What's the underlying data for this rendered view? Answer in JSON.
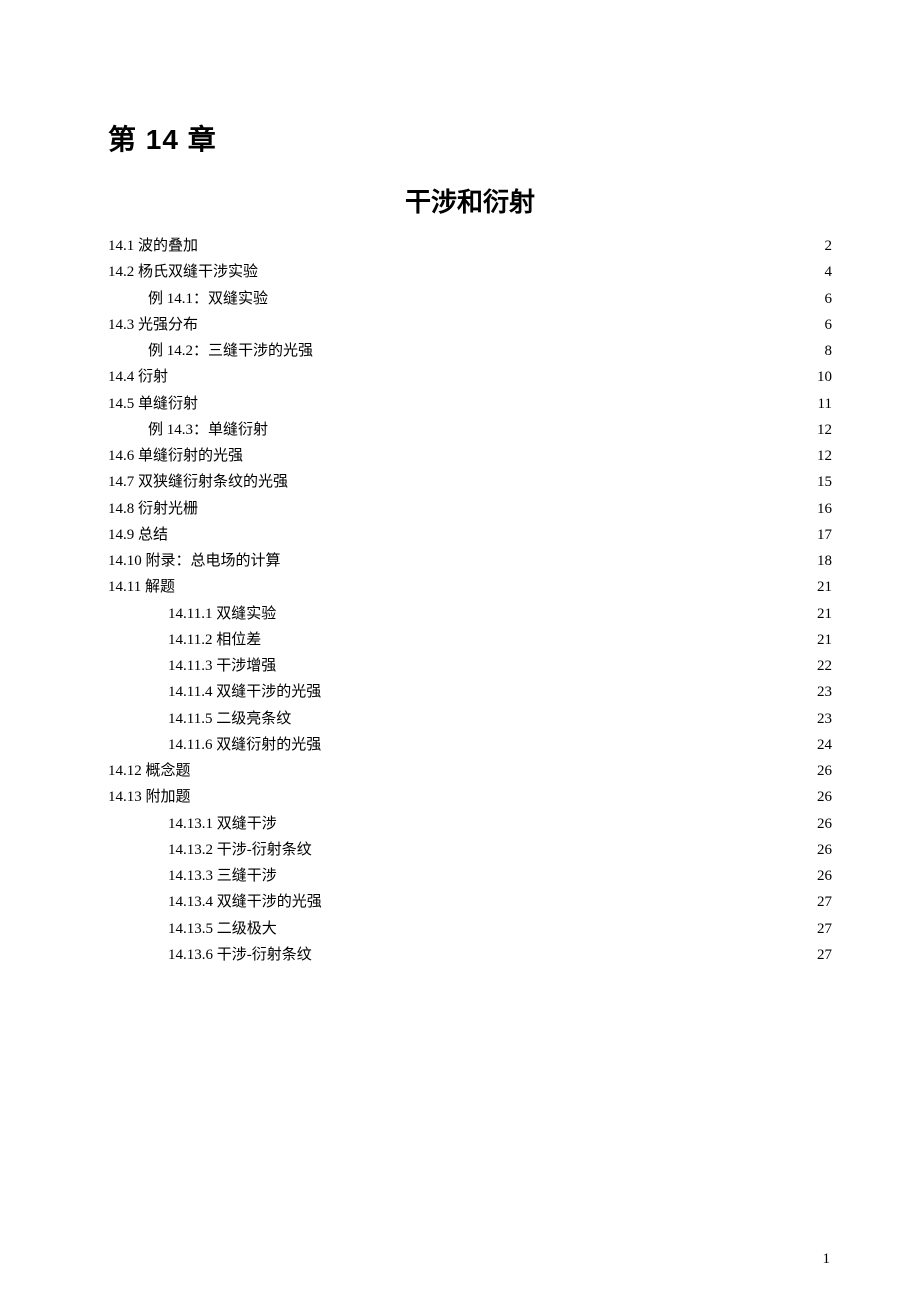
{
  "chapter_heading": "第 14 章",
  "chapter_title": "干涉和衍射",
  "toc": [
    {
      "label": "14.1 波的叠加",
      "page": "2",
      "indent": 0
    },
    {
      "label": "14.2 杨氏双缝干涉实验",
      "page": "4",
      "indent": 0
    },
    {
      "label": "例 14.1：双缝实验",
      "page": "6",
      "indent": 1
    },
    {
      "label": "14.3 光强分布",
      "page": "6",
      "indent": 0
    },
    {
      "label": "例 14.2：三缝干涉的光强",
      "page": "8",
      "indent": 1
    },
    {
      "label": "14.4 衍射",
      "page": "10",
      "indent": 0
    },
    {
      "label": "14.5 单缝衍射",
      "page": "11",
      "indent": 0
    },
    {
      "label": "例 14.3：单缝衍射",
      "page": "12",
      "indent": 1
    },
    {
      "label": "14.6 单缝衍射的光强",
      "page": "12",
      "indent": 0
    },
    {
      "label": "14.7 双狭缝衍射条纹的光强",
      "page": "15",
      "indent": 0
    },
    {
      "label": "14.8 衍射光栅",
      "page": "16",
      "indent": 0
    },
    {
      "label": "14.9 总结",
      "page": "17",
      "indent": 0
    },
    {
      "label": "14.10 附录：总电场的计算",
      "page": "18",
      "indent": 0
    },
    {
      "label": "14.11 解题",
      "page": "21",
      "indent": 0
    },
    {
      "label": "14.11.1 双缝实验",
      "page": "21",
      "indent": 2
    },
    {
      "label": "14.11.2 相位差",
      "page": "21",
      "indent": 2
    },
    {
      "label": "14.11.3 干涉增强",
      "page": "22",
      "indent": 2
    },
    {
      "label": "14.11.4 双缝干涉的光强",
      "page": "23",
      "indent": 2
    },
    {
      "label": "14.11.5 二级亮条纹",
      "page": "23",
      "indent": 2
    },
    {
      "label": "14.11.6 双缝衍射的光强",
      "page": "24",
      "indent": 2
    },
    {
      "label": "14.12 概念题",
      "page": "26",
      "indent": 0
    },
    {
      "label": "14.13 附加题",
      "page": "26",
      "indent": 0
    },
    {
      "label": "14.13.1 双缝干涉",
      "page": "26",
      "indent": 2
    },
    {
      "label": "14.13.2 干涉-衍射条纹",
      "page": "26",
      "indent": 2
    },
    {
      "label": "14.13.3 三缝干涉",
      "page": "26",
      "indent": 2
    },
    {
      "label": "14.13.4 双缝干涉的光强",
      "page": "27",
      "indent": 2
    },
    {
      "label": "14.13.5 二级极大",
      "page": "27",
      "indent": 2
    },
    {
      "label": "14.13.6 干涉-衍射条纹",
      "page": "27",
      "indent": 2
    }
  ],
  "page_number": "1"
}
